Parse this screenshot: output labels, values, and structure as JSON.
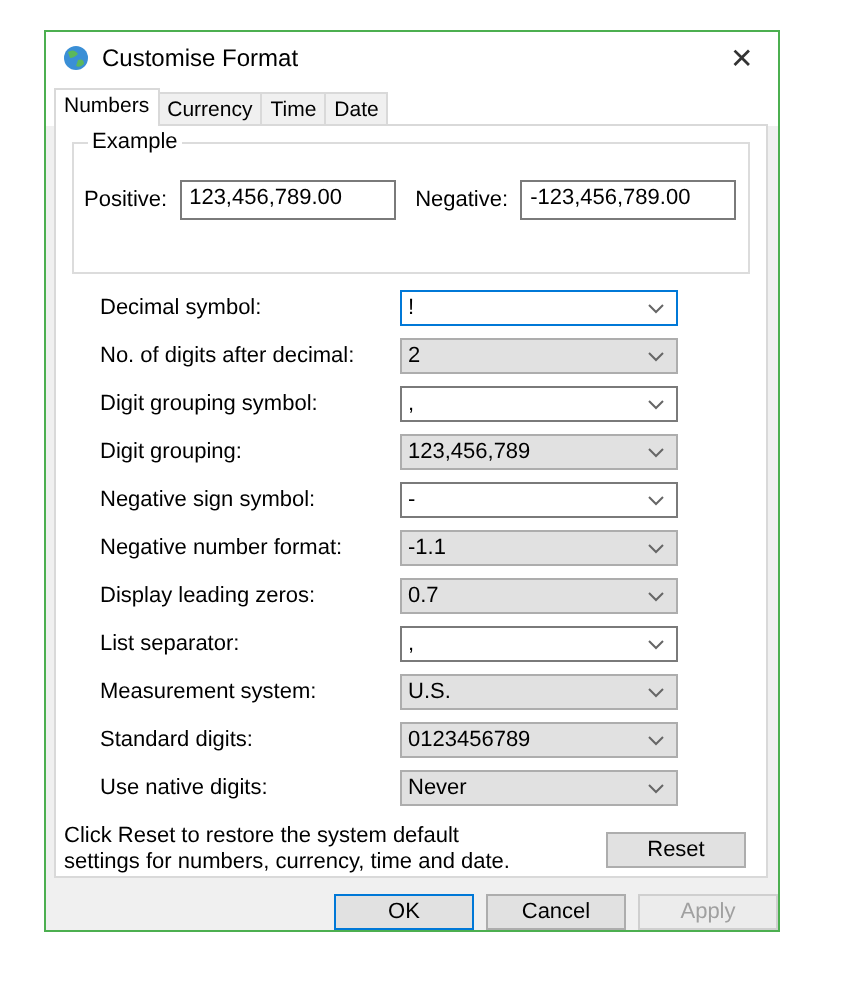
{
  "window": {
    "title": "Customise Format",
    "close": "✕"
  },
  "tabs": [
    {
      "label": "Numbers",
      "selected": true
    },
    {
      "label": "Currency",
      "selected": false
    },
    {
      "label": "Time",
      "selected": false
    },
    {
      "label": "Date",
      "selected": false
    }
  ],
  "example": {
    "title": "Example",
    "positive_label": "Positive:",
    "positive_value": "123,456,789.00",
    "negative_label": "Negative:",
    "negative_value": "-123,456,789.00"
  },
  "settings": [
    {
      "label": "Decimal symbol:",
      "value": "!",
      "kind": "editable",
      "focused": true
    },
    {
      "label": "No. of digits after decimal:",
      "value": "2",
      "kind": "list",
      "focused": false
    },
    {
      "label": "Digit grouping symbol:",
      "value": ",",
      "kind": "editable",
      "focused": false
    },
    {
      "label": "Digit grouping:",
      "value": "123,456,789",
      "kind": "list",
      "focused": false
    },
    {
      "label": "Negative sign symbol:",
      "value": "-",
      "kind": "editable",
      "focused": false
    },
    {
      "label": "Negative number format:",
      "value": "-1.1",
      "kind": "list",
      "focused": false
    },
    {
      "label": "Display leading zeros:",
      "value": "0.7",
      "kind": "list",
      "focused": false
    },
    {
      "label": "List separator:",
      "value": ",",
      "kind": "editable",
      "focused": false
    },
    {
      "label": "Measurement system:",
      "value": "U.S.",
      "kind": "list",
      "focused": false
    },
    {
      "label": "Standard digits:",
      "value": "0123456789",
      "kind": "list",
      "focused": false
    },
    {
      "label": "Use native digits:",
      "value": "Never",
      "kind": "list",
      "focused": false
    }
  ],
  "reset_note": "Click Reset to restore the system default settings for numbers, currency, time and date.",
  "reset_button": "Reset",
  "buttons": [
    {
      "label": "OK",
      "default": true,
      "disabled": false
    },
    {
      "label": "Cancel",
      "default": false,
      "disabled": false
    },
    {
      "label": "Apply",
      "default": false,
      "disabled": true
    }
  ]
}
